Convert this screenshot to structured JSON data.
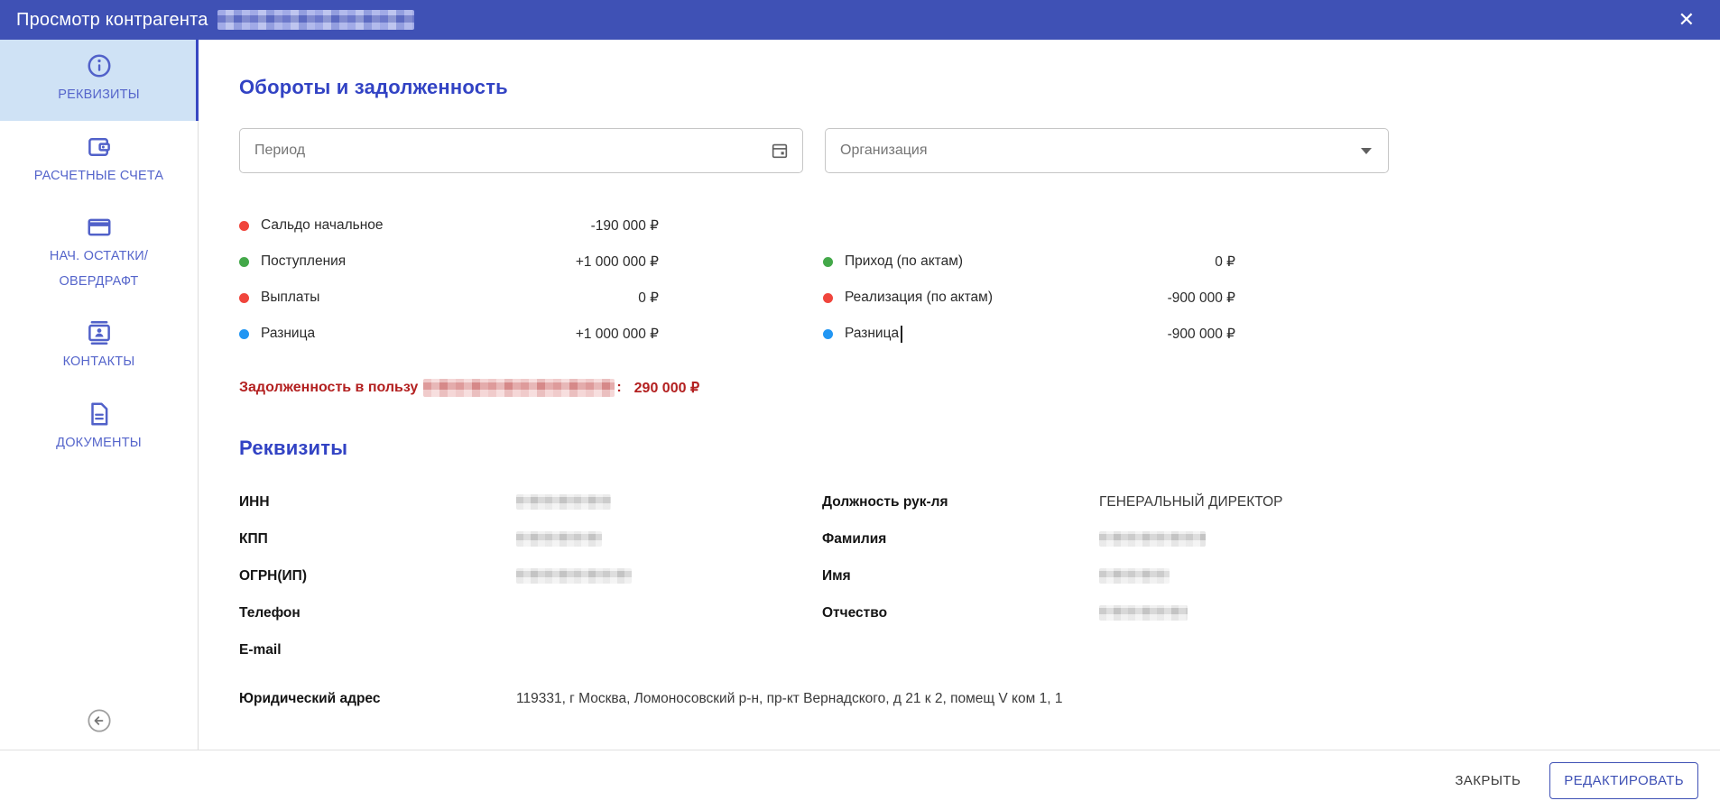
{
  "header": {
    "title": "Просмотр контрагента",
    "subject_redacted": true
  },
  "icons": {
    "close_glyph": "✕"
  },
  "sidebar": {
    "items": [
      {
        "label": "РЕКВИЗИТЫ",
        "icon": "info-icon",
        "selected": true
      },
      {
        "label": "РАСЧЕТНЫЕ СЧЕТА",
        "icon": "wallet-icon",
        "selected": false
      },
      {
        "label": "НАЧ. ОСТАТКИ/ ОВЕРДРАФТ",
        "icon": "card-icon",
        "selected": false
      },
      {
        "label": "КОНТАКТЫ",
        "icon": "contacts-icon",
        "selected": false
      },
      {
        "label": "ДОКУМЕНТЫ",
        "icon": "document-icon",
        "selected": false
      }
    ]
  },
  "turnover": {
    "heading": "Обороты и задолженность",
    "filters": {
      "period_placeholder": "Период",
      "organization_placeholder": "Организация"
    },
    "left_rows": [
      {
        "dot": "red",
        "label": "Сальдо начальное",
        "value": "-190 000 ₽"
      },
      {
        "dot": "green",
        "label": "Поступления",
        "value": "+1 000 000 ₽"
      },
      {
        "dot": "red",
        "label": "Выплаты",
        "value": "0 ₽"
      },
      {
        "dot": "blue",
        "label": "Разница",
        "value": "+1 000 000 ₽"
      }
    ],
    "right_rows": [
      {
        "dot": "green",
        "label": "Приход (по актам)",
        "value": "0 ₽"
      },
      {
        "dot": "red",
        "label": "Реализация (по актам)",
        "value": "-900 000 ₽"
      },
      {
        "dot": "blue",
        "label": "Разница",
        "value": "-900 000 ₽",
        "cursor": true
      }
    ],
    "debt": {
      "prefix": "Задолженность в пользу",
      "beneficiary_redacted": true,
      "suffix": ":",
      "amount": "290 000 ₽"
    }
  },
  "requisites": {
    "heading": "Реквизиты",
    "left": [
      {
        "label": "ИНН",
        "value": null,
        "redacted": true
      },
      {
        "label": "КПП",
        "value": null,
        "redacted": true
      },
      {
        "label": "ОГРН(ИП)",
        "value": null,
        "redacted": true
      },
      {
        "label": "Телефон",
        "value": ""
      },
      {
        "label": "E-mail",
        "value": ""
      }
    ],
    "address": {
      "label": "Юридический адрес",
      "value": "119331, г Москва, Ломоносовский р-н, пр-кт Вернадского, д 21 к 2, помещ V ком 1, 1"
    },
    "right": [
      {
        "label": "Должность рук-ля",
        "value": "ГЕНЕРАЛЬНЫЙ ДИРЕКТОР"
      },
      {
        "label": "Фамилия",
        "value": null,
        "redacted": true
      },
      {
        "label": "Имя",
        "value": null,
        "redacted": true
      },
      {
        "label": "Отчество",
        "value": null,
        "redacted": true
      }
    ]
  },
  "footer": {
    "close_label": "ЗАКРЫТЬ",
    "edit_label": "РЕДАКТИРОВАТЬ"
  },
  "colors": {
    "accent": "#3f51b5",
    "heading_blue": "#3243c4",
    "selected_item_bg": "#cfe2f5",
    "debt_red": "#b32020",
    "dot_red": "#f0453c",
    "dot_green": "#43a849",
    "dot_blue": "#2196f3"
  }
}
